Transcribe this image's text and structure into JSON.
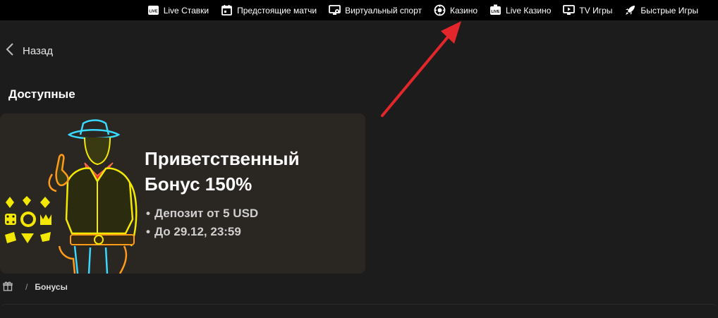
{
  "nav": {
    "items": [
      {
        "label": "Live Ставки",
        "icon": "live-icon"
      },
      {
        "label": "Предстоящие матчи",
        "icon": "calendar-icon"
      },
      {
        "label": "Виртуальный спорт",
        "icon": "virtual-sport-icon"
      },
      {
        "label": "Казино",
        "icon": "casino-chip-icon"
      },
      {
        "label": "Live Казино",
        "icon": "live-casino-icon"
      },
      {
        "label": "TV Игры",
        "icon": "tv-icon"
      },
      {
        "label": "Быстрые Игры",
        "icon": "rocket-icon"
      }
    ]
  },
  "back": {
    "label": "Назад",
    "icon": "chevron-left-icon"
  },
  "section": {
    "title": "Доступные"
  },
  "bonus": {
    "title": "Приветственный Бонус 150%",
    "details": [
      "Депозит от 5 USD",
      "До 29.12, 23:59"
    ],
    "bullet": "•"
  },
  "breadcrumb": {
    "separator": "/",
    "current": "Бонусы",
    "home_icon": "gift-icon"
  },
  "colors": {
    "topbar_bg": "#000000",
    "page_bg": "#1c1c1c",
    "card_bg": "#2a2622",
    "neon_yellow": "#f5e800",
    "annotation_red": "#e3262b"
  }
}
